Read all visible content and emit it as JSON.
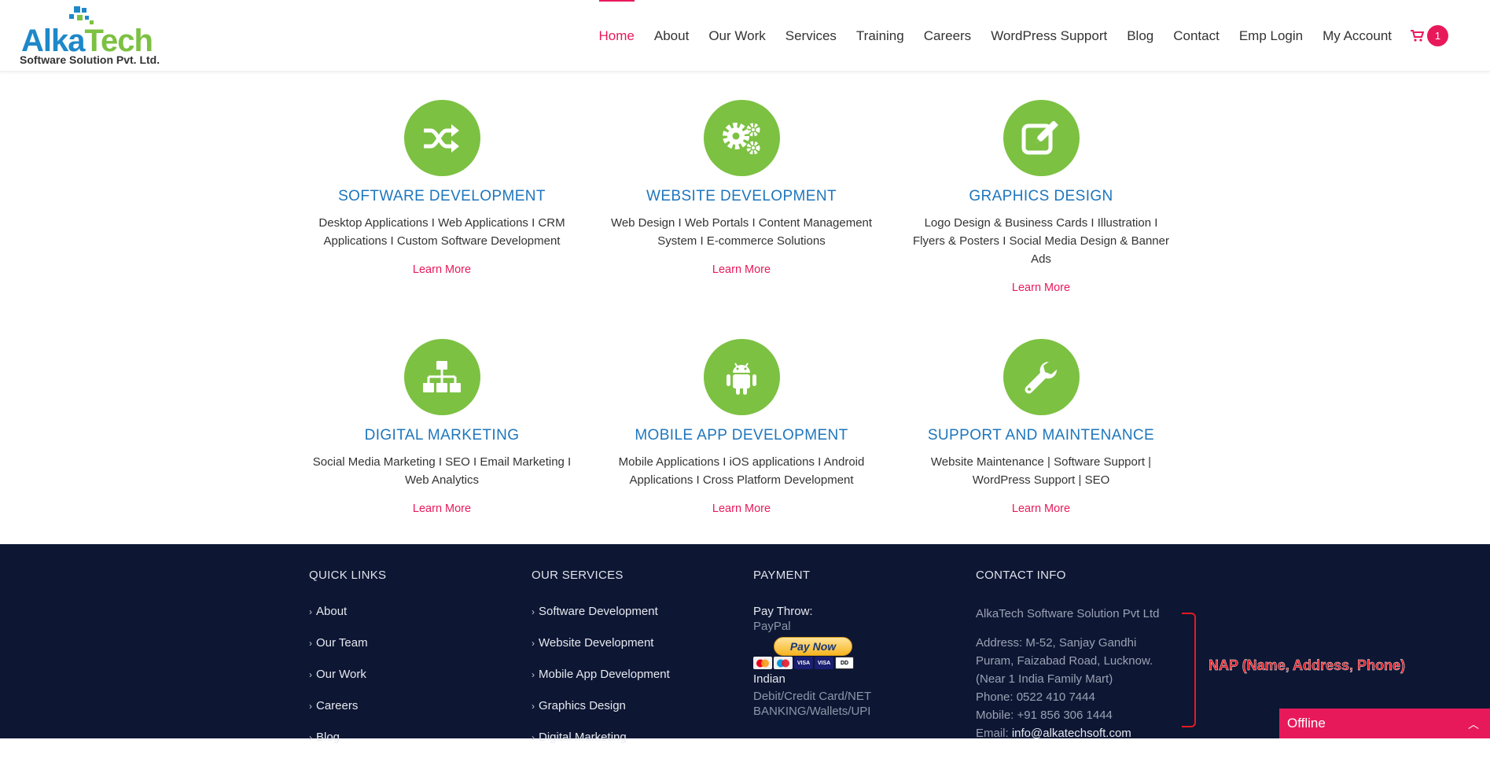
{
  "brand": {
    "name_part1": "Alka",
    "name_part2": "Tech",
    "tagline": "Software Solution Pvt. Ltd.",
    "colors": {
      "blue": "#1e88c9",
      "green": "#7cc142",
      "pink": "#e8195b"
    }
  },
  "nav": {
    "items": [
      "Home",
      "About",
      "Our Work",
      "Services",
      "Training",
      "Careers",
      "WordPress Support",
      "Blog",
      "Contact",
      "Emp Login",
      "My Account"
    ],
    "active": "Home",
    "cart_icon": "cart-icon",
    "cart_count": "1"
  },
  "services": [
    {
      "icon": "shuffle-icon",
      "title": "SOFTWARE DEVELOPMENT",
      "desc": "Desktop Applications I Web Applications I CRM Applications  I Custom Software Development",
      "link": "Learn More"
    },
    {
      "icon": "gears-icon",
      "title": "WEBSITE DEVELOPMENT",
      "desc": "Web Design I Web Portals I Content Management System I E-commerce Solutions",
      "link": "Learn More"
    },
    {
      "icon": "edit-icon",
      "title": "GRAPHICS DESIGN",
      "desc": "Logo Design & Business Cards I Illustration I Flyers & Posters I Social Media Design & Banner Ads",
      "link": "Learn More"
    },
    {
      "icon": "sitemap-icon",
      "title": "DIGITAL MARKETING",
      "desc": "Social Media Marketing I SEO I Email Marketing I Web Analytics",
      "link": "Learn More"
    },
    {
      "icon": "android-icon",
      "title": "MOBILE APP DEVELOPMENT",
      "desc": "Mobile Applications I iOS applications I Android Applications I Cross Platform Development",
      "link": "Learn More"
    },
    {
      "icon": "wrench-icon",
      "title": "SUPPORT AND MAINTENANCE",
      "desc": "Website Maintenance | Software Support | WordPress Support | SEO",
      "link": "Learn More"
    }
  ],
  "footer": {
    "quick_links": {
      "heading": "QUICK LINKS",
      "items": [
        "About",
        "Our Team",
        "Our Work",
        "Careers",
        "Blog"
      ]
    },
    "our_services": {
      "heading": "OUR SERVICES",
      "items": [
        "Software Development",
        "Website Development",
        "Mobile App Development",
        "Graphics Design",
        "Digital Marketing"
      ]
    },
    "payment": {
      "heading": "PAYMENT",
      "pay_throw": "Pay Throw:",
      "paypal": "PayPal",
      "paypal_button": "Pay Now",
      "indian": "Indian",
      "indian_methods_1": "Debit/Credit Card/NET",
      "indian_methods_2": "BANKING/Wallets/UPI"
    },
    "contact": {
      "heading": "CONTACT INFO",
      "company": "AlkaTech Software Solution Pvt Ltd",
      "address_1": "Address: M-52, Sanjay Gandhi",
      "address_2": "Puram, Faizabad Road, Lucknow.",
      "address_3": "(Near 1 India Family Mart)",
      "phone": "Phone: 0522 410 7444",
      "mobile": "Mobile: +91 856 306 1444",
      "email_label": "Email: ",
      "email": "info@alkatechsoft.com"
    }
  },
  "annotation": {
    "label": "NAP (Name, Address, Phone)",
    "color": "#e31b23"
  },
  "chat": {
    "status": "Offline",
    "caret_icon": "chevron-up-icon"
  }
}
